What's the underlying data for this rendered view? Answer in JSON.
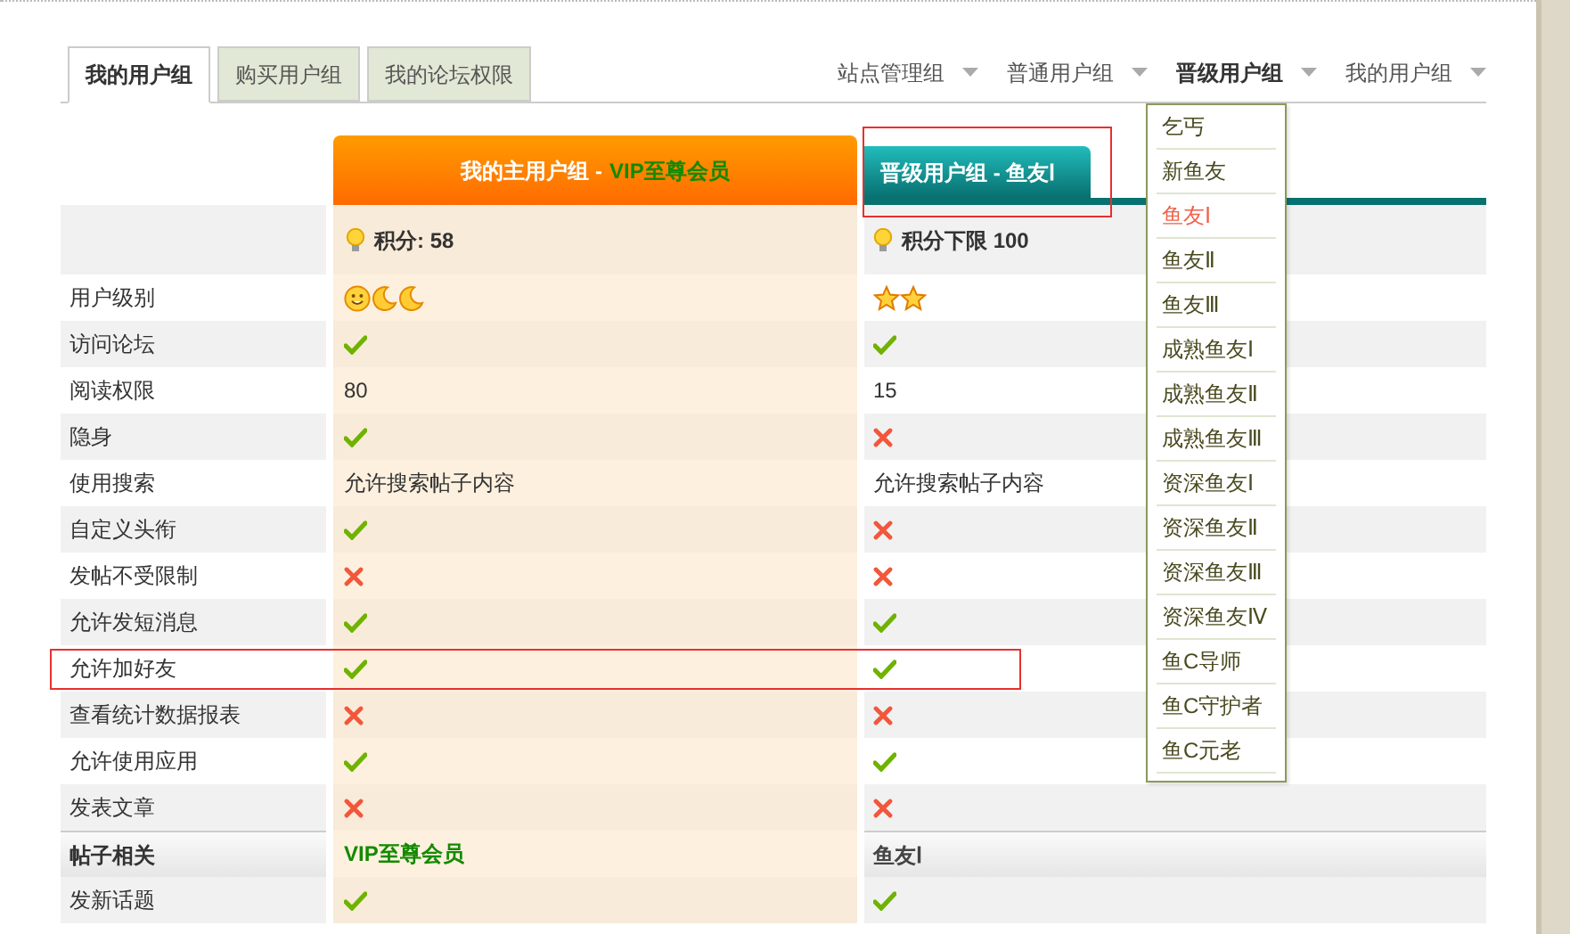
{
  "tabs": [
    {
      "label": "我的用户组",
      "selected": true
    },
    {
      "label": "购买用户组",
      "selected": false
    },
    {
      "label": "我的论坛权限",
      "selected": false
    }
  ],
  "nav": [
    {
      "label": "站点管理组",
      "active": false
    },
    {
      "label": "普通用户组",
      "active": false
    },
    {
      "label": "晋级用户组",
      "active": true
    },
    {
      "label": "我的用户组",
      "active": false
    }
  ],
  "dropdown": [
    {
      "label": "乞丐",
      "selected": false
    },
    {
      "label": "新鱼友",
      "selected": false
    },
    {
      "label": "鱼友Ⅰ",
      "selected": true
    },
    {
      "label": "鱼友Ⅱ",
      "selected": false
    },
    {
      "label": "鱼友Ⅲ",
      "selected": false
    },
    {
      "label": "成熟鱼友Ⅰ",
      "selected": false
    },
    {
      "label": "成熟鱼友Ⅱ",
      "selected": false
    },
    {
      "label": "成熟鱼友Ⅲ",
      "selected": false
    },
    {
      "label": "资深鱼友Ⅰ",
      "selected": false
    },
    {
      "label": "资深鱼友Ⅱ",
      "selected": false
    },
    {
      "label": "资深鱼友Ⅲ",
      "selected": false
    },
    {
      "label": "资深鱼友Ⅳ",
      "selected": false
    },
    {
      "label": "鱼C导师",
      "selected": false
    },
    {
      "label": "鱼C守护者",
      "selected": false
    },
    {
      "label": "鱼C元老",
      "selected": false
    }
  ],
  "columns": [
    {
      "title": "我的主用户组 -",
      "group": "VIP至尊会员",
      "score": "积分: 58"
    },
    {
      "title": "晋级用户组 - 鱼友Ⅰ",
      "score": "积分下限 100",
      "highlighted": true
    }
  ],
  "rows": [
    {
      "label": "用户级别",
      "kind": "plain",
      "highlighted": false,
      "cells": [
        {
          "kind": "icons",
          "icons": [
            {
              "kind": "sun"
            },
            {
              "kind": "moon"
            },
            {
              "kind": "moon"
            }
          ]
        },
        {
          "kind": "icons",
          "icons": [
            {
              "kind": "star"
            },
            {
              "kind": "star"
            }
          ]
        }
      ]
    },
    {
      "label": "访问论坛",
      "kind": "plain",
      "highlighted": false,
      "cells": [
        {
          "kind": "check"
        },
        {
          "kind": "check"
        }
      ]
    },
    {
      "label": "阅读权限",
      "kind": "plain",
      "highlighted": false,
      "cells": [
        {
          "kind": "text",
          "text": "80"
        },
        {
          "kind": "text",
          "text": "15"
        }
      ]
    },
    {
      "label": "隐身",
      "kind": "plain",
      "highlighted": false,
      "cells": [
        {
          "kind": "check"
        },
        {
          "kind": "cross"
        }
      ]
    },
    {
      "label": "使用搜索",
      "kind": "plain",
      "highlighted": false,
      "cells": [
        {
          "kind": "text",
          "text": "允许搜索帖子内容"
        },
        {
          "kind": "text",
          "text": "允许搜索帖子内容"
        }
      ]
    },
    {
      "label": "自定义头衔",
      "kind": "plain",
      "highlighted": false,
      "cells": [
        {
          "kind": "check"
        },
        {
          "kind": "cross"
        }
      ]
    },
    {
      "label": "发帖不受限制",
      "kind": "plain",
      "highlighted": false,
      "cells": [
        {
          "kind": "cross"
        },
        {
          "kind": "cross"
        }
      ]
    },
    {
      "label": "允许发短消息",
      "kind": "plain",
      "highlighted": false,
      "cells": [
        {
          "kind": "check"
        },
        {
          "kind": "check"
        }
      ]
    },
    {
      "label": "允许加好友",
      "kind": "plain",
      "highlighted": true,
      "cells": [
        {
          "kind": "check"
        },
        {
          "kind": "check"
        }
      ]
    },
    {
      "label": "查看统计数据报表",
      "kind": "plain",
      "highlighted": false,
      "cells": [
        {
          "kind": "cross"
        },
        {
          "kind": "cross"
        }
      ]
    },
    {
      "label": "允许使用应用",
      "kind": "plain",
      "highlighted": false,
      "cells": [
        {
          "kind": "check"
        },
        {
          "kind": "check"
        }
      ]
    },
    {
      "label": "发表文章",
      "kind": "plain",
      "highlighted": false,
      "cells": [
        {
          "kind": "cross"
        },
        {
          "kind": "cross"
        }
      ]
    },
    {
      "label": "帖子相关",
      "kind": "section",
      "highlighted": false,
      "cells": [
        {
          "kind": "group",
          "text": "VIP至尊会员"
        },
        {
          "kind": "group",
          "text": "鱼友Ⅰ"
        }
      ]
    },
    {
      "label": "发新话题",
      "kind": "plain",
      "highlighted": false,
      "cells": [
        {
          "kind": "check"
        },
        {
          "kind": "check"
        }
      ]
    }
  ]
}
